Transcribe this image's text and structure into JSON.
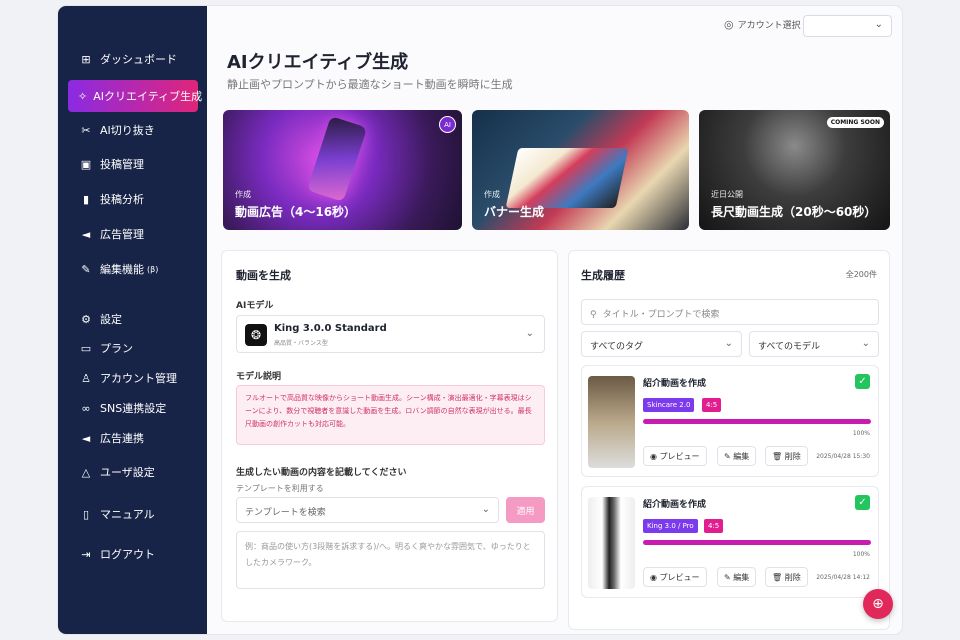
{
  "sidebar": {
    "items": [
      {
        "label": "ダッシュボード",
        "icon": "grid-icon",
        "active": false
      },
      {
        "label": "AIクリエイティブ生成",
        "icon": "sparkle-wand-icon",
        "active": true
      },
      {
        "label": "AI切り抜き",
        "icon": "scissors-icon",
        "active": false
      },
      {
        "label": "投稿管理",
        "icon": "post-icon",
        "active": false
      },
      {
        "label": "投稿分析",
        "icon": "bar-chart-icon",
        "active": false
      },
      {
        "label": "広告管理",
        "icon": "megaphone-icon",
        "active": false
      },
      {
        "label": "編集機能",
        "badge": "(β)",
        "icon": "edit-pen-icon",
        "active": false
      },
      {
        "label": "設定",
        "icon": "gear-icon",
        "active": false
      },
      {
        "label": "プラン",
        "icon": "card-icon",
        "active": false
      },
      {
        "label": "アカウント管理",
        "icon": "user-icon",
        "active": false
      },
      {
        "label": "SNS連携設定",
        "icon": "link-icon",
        "active": false
      },
      {
        "label": "広告連携",
        "icon": "megaphone-link-icon",
        "active": false
      },
      {
        "label": "ユーザ設定",
        "icon": "user-settings-icon",
        "active": false
      },
      {
        "label": "マニュアル",
        "icon": "book-icon",
        "active": false
      },
      {
        "label": "ログアウト",
        "icon": "logout-icon",
        "active": false
      }
    ]
  },
  "header": {
    "account_label": "アカウント選択",
    "account_value": ""
  },
  "page": {
    "title": "AIクリエイティブ生成",
    "subtitle": "静止画やプロンプトから最適なショート動画を瞬時に生成"
  },
  "cards": [
    {
      "category": "作成",
      "title": "動画広告（4〜16秒）",
      "badge": "AI"
    },
    {
      "category": "作成",
      "title": "バナー生成",
      "badge": ""
    },
    {
      "category": "近日公開",
      "title": "長尺動画生成（20秒〜60秒）",
      "badge": "COMING SOON"
    }
  ],
  "generate": {
    "title": "動画を生成",
    "model_label": "AIモデル",
    "model_name": "King 3.0.0 Standard",
    "model_sub": "高品質・バランス型",
    "desc_label": "モデル説明",
    "desc_text": "フルオートで高品質な映像からショート動画生成。シーン構成・演出最適化・字幕表現はシーンにより、数分で視聴者を意識した動画を生成。ロバン調節の自然な表現が出せる。最長尺動画の創作カットも対応可能。",
    "content_label": "生成したい動画の内容を記載してください",
    "template_label": "テンプレートを利用する",
    "template_placeholder": "テンプレートを検索",
    "apply_label": "適用",
    "textarea_placeholder": "例：商品の使い方(3段階を訴求する)/へ。明るく爽やかな雰囲気で、ゆったりとしたカメラワーク。"
  },
  "history": {
    "title": "生成履歴",
    "count": "全200件",
    "search_placeholder": "タイトル・プロンプトで検索",
    "filter_tag": "すべてのタグ",
    "filter_model": "すべてのモデル",
    "items": [
      {
        "title": "紹介動画を作成",
        "tags": [
          "Skincare 2.0",
          "4:5"
        ],
        "progress": "100%",
        "date": "2025/04/28 15:30",
        "preview": "プレビュー",
        "edit": "編集",
        "delete": "削除"
      },
      {
        "title": "紹介動画を作成",
        "tags": [
          "King 3.0 / Pro",
          "4:5"
        ],
        "progress": "100%",
        "date": "2025/04/28 14:12",
        "preview": "プレビュー",
        "edit": "編集",
        "delete": "削除"
      }
    ]
  },
  "colors": {
    "sidebar": "#182447",
    "accent": "#e0257a",
    "purple": "#8a2be2",
    "tag_purple": "#7c3aed",
    "tag_pink": "#e11d8f",
    "check": "#22c55e"
  }
}
